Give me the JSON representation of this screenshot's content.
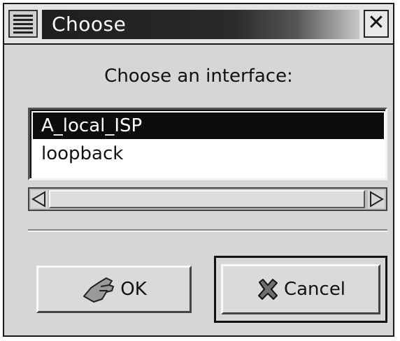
{
  "window": {
    "title": "Choose",
    "close_glyph": "✕",
    "menu_icon": "menu-lines-icon"
  },
  "dialog": {
    "prompt": "Choose an interface:"
  },
  "interfaces": {
    "items": [
      {
        "label": "A_local_ISP",
        "selected": true
      },
      {
        "label": "loopback",
        "selected": false
      }
    ]
  },
  "buttons": {
    "ok_label": "OK",
    "ok_icon": "hand-pointing-icon",
    "cancel_label": "Cancel",
    "cancel_icon": "x-mark-icon"
  },
  "colors": {
    "selection_bg": "#0c0c0c",
    "selection_fg": "#ffffff",
    "window_bg": "#d6d6d6"
  }
}
